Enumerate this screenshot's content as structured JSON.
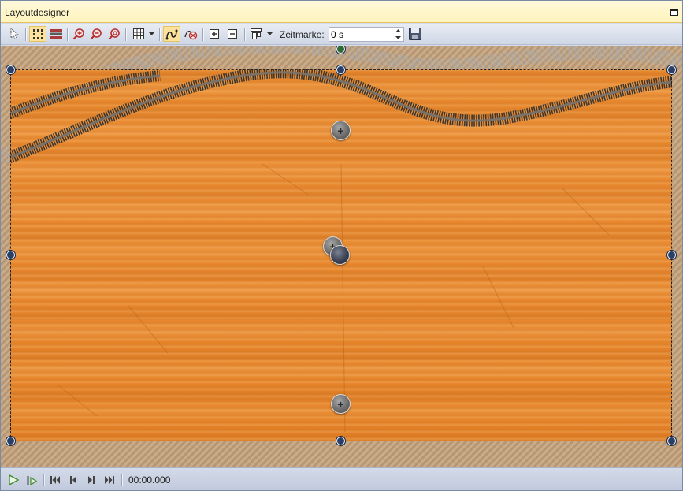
{
  "window": {
    "title": "Layoutdesigner"
  },
  "toolbar": {
    "tools": [
      {
        "icon": "select-arrow-icon"
      },
      {
        "icon": "point-edit-icon",
        "active": true
      },
      {
        "icon": "layers-icon"
      },
      {
        "icon": "zoom-in-icon"
      },
      {
        "icon": "zoom-out-icon"
      },
      {
        "icon": "zoom-fit-icon"
      },
      {
        "icon": "grid-icon"
      },
      {
        "icon": "grid-dropdown-icon"
      },
      {
        "icon": "path-curve-icon",
        "active": true
      },
      {
        "icon": "path-reset-icon"
      },
      {
        "icon": "add-point-icon"
      },
      {
        "icon": "remove-point-icon"
      },
      {
        "icon": "align-icon"
      },
      {
        "icon": "align-dropdown-icon"
      }
    ],
    "zeitmarke_label": "Zeitmarke:",
    "zeitmarke_value": "0 s",
    "save_icon": "save-icon"
  },
  "playback": {
    "buttons": [
      {
        "icon": "play-icon"
      },
      {
        "icon": "play-from-icon"
      },
      {
        "icon": "skip-to-start-icon"
      },
      {
        "icon": "step-back-icon"
      },
      {
        "icon": "step-forward-icon"
      },
      {
        "icon": "skip-to-end-icon"
      }
    ],
    "time": "00:00.000"
  },
  "colors": {
    "selection_handle": "#2b3f66",
    "rotation_handle": "#2f6b33",
    "wood": "#e9892e",
    "titlebar": "#fff3bd"
  }
}
